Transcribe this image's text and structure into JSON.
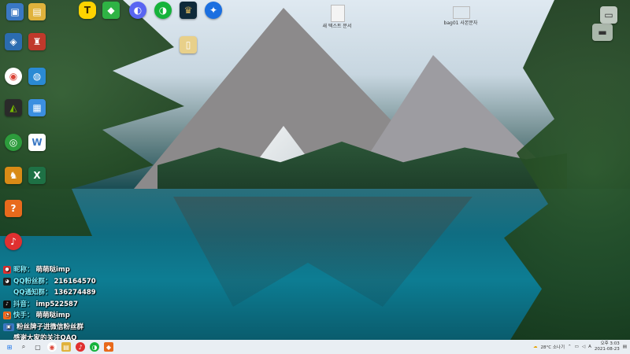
{
  "overlay": {
    "row1": {
      "key": "昵称：",
      "value": "萌萌哒imp"
    },
    "row2": {
      "key": "QQ粉丝群：",
      "value": "216164570"
    },
    "row3": {
      "key": "QQ通知群：",
      "value": "136274489"
    },
    "row4": {
      "key": "抖音：",
      "value": "imp522587"
    },
    "row5": {
      "key": "快手：",
      "value": "萌萌哒imp"
    },
    "row6": {
      "text": "粉丝牌子进微信粉丝群"
    },
    "row7": {
      "text": "感谢大家的关注QAQ"
    }
  },
  "desktop_files": {
    "file1": "새 텍스트 문서",
    "file2": "bag01 사본문자"
  },
  "tray": {
    "weather": "28°C 소나기",
    "time": "오후 3:03",
    "date": "2021-08-23"
  },
  "colors": {
    "accent": "#7ef0ff",
    "taskbar": "#e9eef3"
  }
}
